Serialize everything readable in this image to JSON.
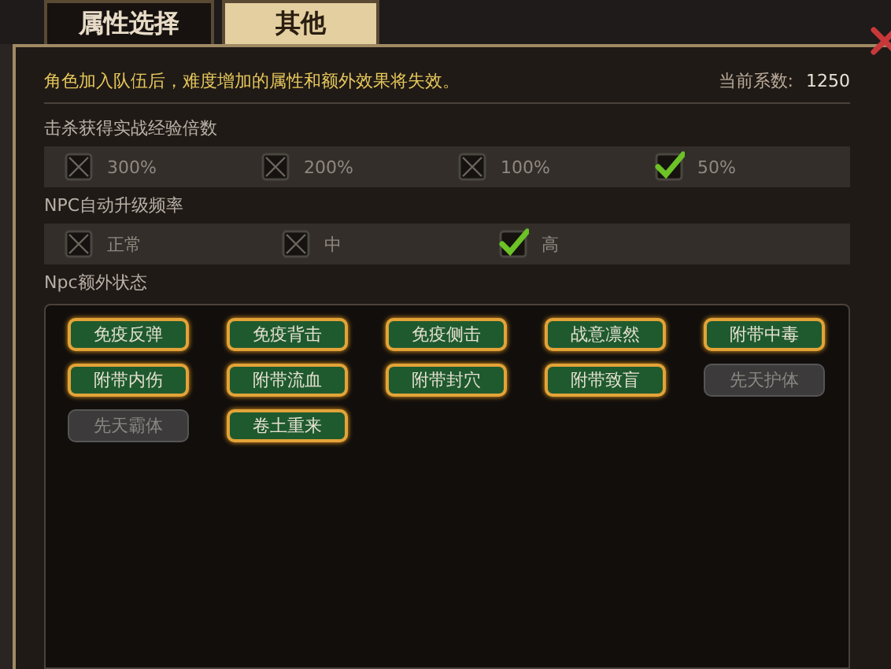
{
  "tabs": [
    {
      "label": "属性选择",
      "selected": false
    },
    {
      "label": "其他",
      "selected": true
    }
  ],
  "notice": "角色加入队伍后，难度增加的属性和额外效果将失效。",
  "coefficient": {
    "label": "当前系数:",
    "value": "1250"
  },
  "groups": [
    {
      "title": "击杀获得实战经验倍数",
      "options": [
        {
          "label": "300%",
          "checked": false
        },
        {
          "label": "200%",
          "checked": false
        },
        {
          "label": "100%",
          "checked": false
        },
        {
          "label": "50%",
          "checked": true
        }
      ]
    },
    {
      "title": "NPC自动升级频率",
      "options": [
        {
          "label": "正常",
          "checked": false
        },
        {
          "label": "中",
          "checked": false
        },
        {
          "label": "高",
          "checked": true
        }
      ]
    }
  ],
  "extra": {
    "title": "Npc额外状态",
    "chips": [
      {
        "label": "免疫反弹",
        "selected": true
      },
      {
        "label": "免疫背击",
        "selected": true
      },
      {
        "label": "免疫侧击",
        "selected": true
      },
      {
        "label": "战意凛然",
        "selected": true
      },
      {
        "label": "附带中毒",
        "selected": true
      },
      {
        "label": "附带内伤",
        "selected": true
      },
      {
        "label": "附带流血",
        "selected": true
      },
      {
        "label": "附带封穴",
        "selected": true
      },
      {
        "label": "附带致盲",
        "selected": true
      },
      {
        "label": "先天护体",
        "selected": false
      },
      {
        "label": "先天霸体",
        "selected": false
      },
      {
        "label": "卷土重来",
        "selected": true
      }
    ]
  }
}
